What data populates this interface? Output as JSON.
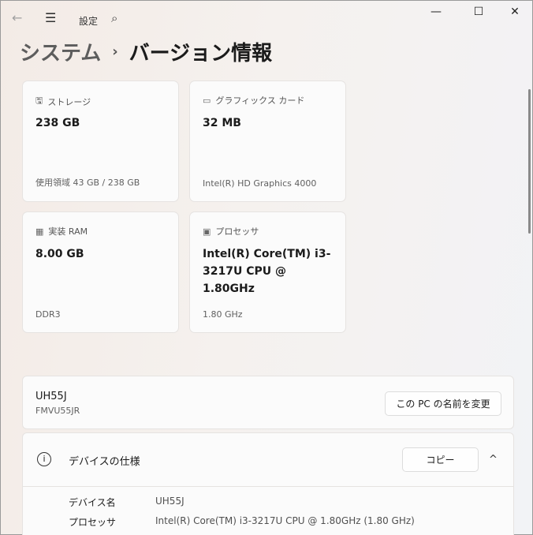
{
  "titlebar": {
    "app_title": "設定",
    "back_icon": "←",
    "menu_icon": "☰",
    "search_icon": "⌕",
    "minimize": "—",
    "maximize": "☐",
    "close": "✕"
  },
  "breadcrumb": {
    "parent": "システム",
    "separator": "›",
    "current": "バージョン情報"
  },
  "cards": [
    {
      "icon": "🖫",
      "label": "ストレージ",
      "value": "238 GB",
      "sub": "使用領域 43 GB / 238 GB"
    },
    {
      "icon": "▭",
      "label": "グラフィックス カード",
      "value": "32 MB",
      "sub": "Intel(R) HD Graphics 4000"
    },
    {
      "icon": "▦",
      "label": "実装 RAM",
      "value": "8.00 GB",
      "sub": "DDR3"
    },
    {
      "icon": "▣",
      "label": "プロセッサ",
      "value": "Intel(R) Core(TM) i3-3217U CPU @ 1.80GHz",
      "sub": "1.80 GHz"
    }
  ],
  "device": {
    "name": "UH55J",
    "model": "FMVU55JR",
    "rename_button": "この PC の名前を変更"
  },
  "specs": {
    "info_icon": "i",
    "title": "デバイスの仕様",
    "copy_button": "コピー",
    "collapse_icon": "^",
    "rows": [
      {
        "key": "デバイス名",
        "value": "UH55J"
      },
      {
        "key": "プロセッサ",
        "value": "Intel(R) Core(TM) i3-3217U CPU @ 1.80GHz (1.80 GHz)"
      }
    ]
  }
}
